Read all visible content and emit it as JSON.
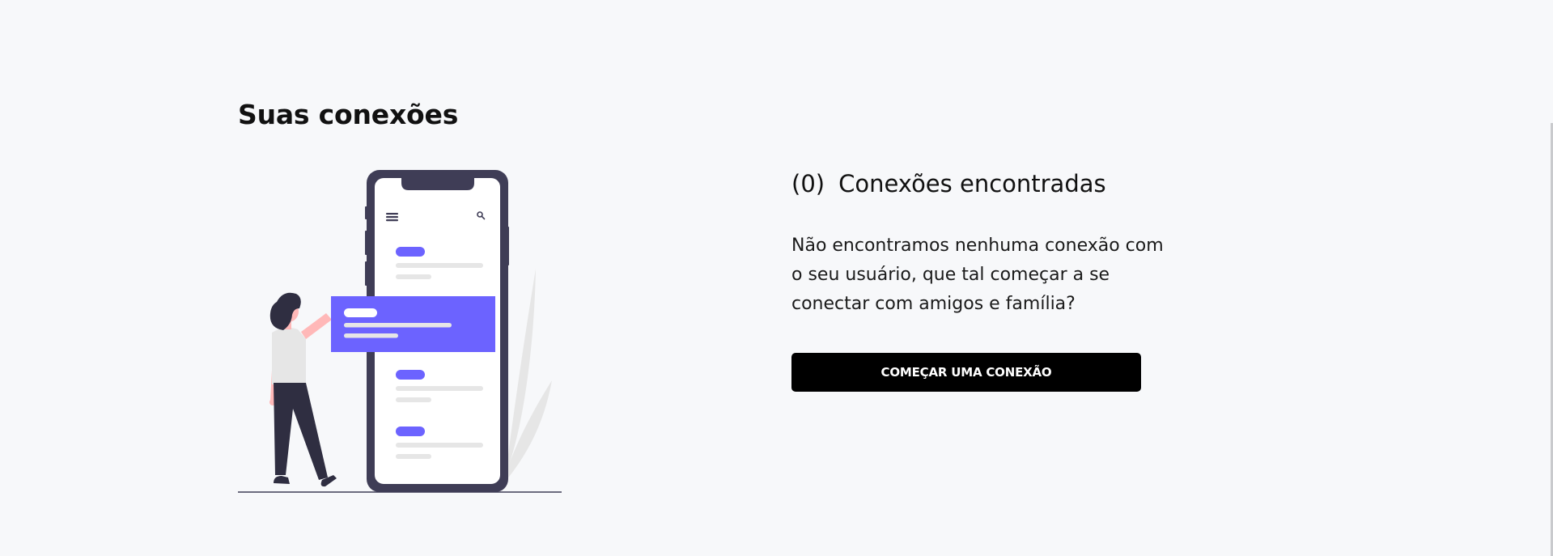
{
  "page": {
    "title": "Suas conexões"
  },
  "connections": {
    "count": "(0)",
    "heading": "Conexões encontradas",
    "description": "Não encontramos nenhuma conexão com o seu usuário, que tal começar a se conectar com amigos e família?",
    "cta_label": "COMEÇAR UMA CONEXÃO"
  },
  "illustration": {
    "icons": [
      "menu-icon",
      "search-icon"
    ]
  },
  "colors": {
    "background": "#f7f8fa",
    "accent": "#6c63ff",
    "phone_frame": "#3f3d56",
    "button_bg": "#000000",
    "button_text": "#ffffff"
  }
}
